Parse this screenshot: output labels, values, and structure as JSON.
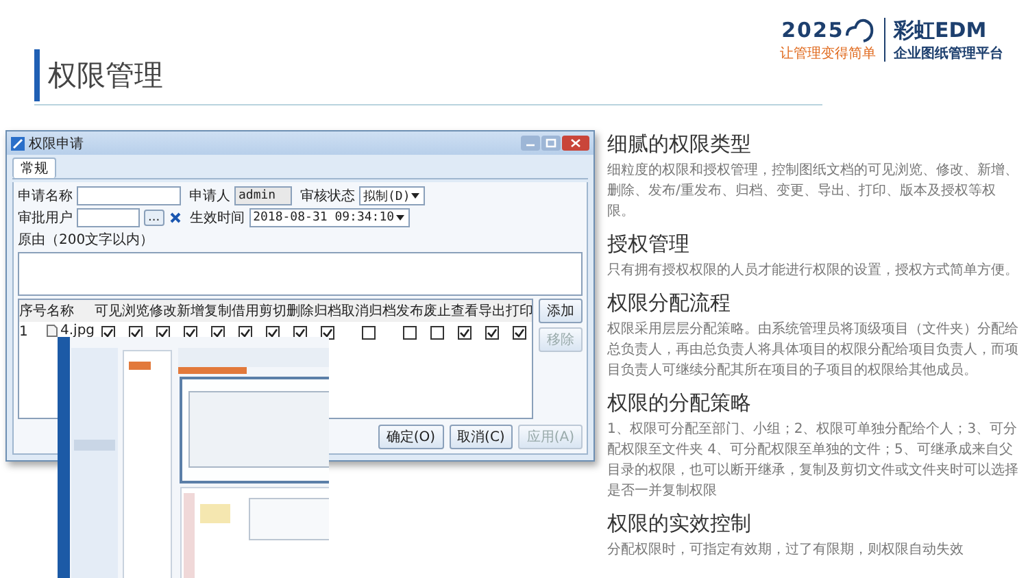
{
  "title": "权限管理",
  "logo": {
    "year": "2025",
    "slogan": "让管理变得简单",
    "brand": "彩虹EDM",
    "subtitle": "企业图纸管理平台"
  },
  "dialog": {
    "title": "权限申请",
    "tabs": [
      {
        "label": "常规",
        "selected": true
      }
    ],
    "fields": [
      {
        "label": "申请名称",
        "kind": "text"
      },
      {
        "label": "申请人",
        "kind": "readonly",
        "value": "admin"
      },
      {
        "label": "审核状态",
        "kind": "select",
        "value": "拟制(D)"
      },
      {
        "label": "审批用户",
        "kind": "picker",
        "button_text": "..."
      },
      {
        "label": "生效时间",
        "kind": "select",
        "value": "2018-08-31 09:34:10"
      }
    ],
    "reason_label": "原由（200文字以内）",
    "table": {
      "columns": [
        "序号",
        "名称",
        "可见",
        "浏览",
        "修改",
        "新增",
        "复制",
        "借用",
        "剪切",
        "删除",
        "归档",
        "取消归档",
        "发布",
        "废止",
        "查看",
        "导出",
        "打印"
      ],
      "rows": [
        {
          "index": "1",
          "name": "4.jpg",
          "checks": [
            true,
            true,
            true,
            true,
            true,
            true,
            true,
            true,
            true,
            false,
            false,
            false,
            true,
            true,
            true
          ]
        }
      ]
    },
    "side_buttons": [
      {
        "label": "添加",
        "disabled": false
      },
      {
        "label": "移除",
        "disabled": true
      }
    ],
    "footer_buttons": [
      {
        "label": "确定(O)",
        "disabled": false
      },
      {
        "label": "取消(C)",
        "disabled": false
      },
      {
        "label": "应用(A)",
        "disabled": true
      }
    ]
  },
  "sections": [
    {
      "heading": "细腻的权限类型",
      "body": "细粒度的权限和授权管理，控制图纸文档的可见浏览、修改、新增、删除、发布/重发布、归档、变更、导出、打印、版本及授权等权限。"
    },
    {
      "heading": "授权管理",
      "body": "只有拥有授权权限的人员才能进行权限的设置，授权方式简单方便。"
    },
    {
      "heading": "权限分配流程",
      "body": "权限采用层层分配策略。由系统管理员将顶级项目（文件夹）分配给总负责人，再由总负责人将具体项目的权限分配给项目负责人，而项目负责人可继续分配其所在项目的子项目的权限给其他成员。"
    },
    {
      "heading": "权限的分配策略",
      "body": "1、权限可分配至部门、小组；2、权限可单独分配给个人；3、可分配权限至文件夹 4、可分配权限至单独的文件；5、可继承成来自父目录的权限，也可以断开继承，复制及剪切文件或文件夹时可以选择是否一并复制权限"
    },
    {
      "heading": "权限的实效控制",
      "body": "分配权限时，可指定有效期，过了有限期，则权限自动失效"
    }
  ]
}
